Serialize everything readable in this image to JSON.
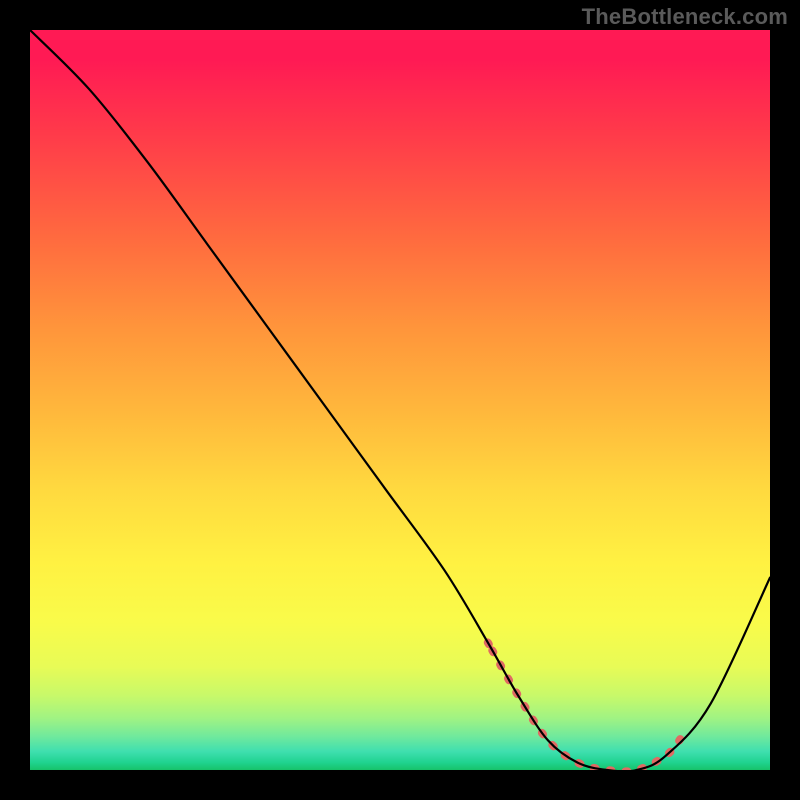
{
  "watermark": "TheBottleneck.com",
  "chart_data": {
    "type": "line",
    "title": "",
    "xlabel": "",
    "ylabel": "",
    "xlim": [
      0,
      100
    ],
    "ylim": [
      0,
      100
    ],
    "grid": false,
    "series": [
      {
        "name": "curve",
        "x": [
          0,
          8,
          16,
          24,
          32,
          40,
          48,
          56,
          62,
          66,
          70,
          74,
          78,
          82,
          86,
          92,
          100
        ],
        "y": [
          100,
          92,
          82,
          71,
          60,
          49,
          38,
          27,
          17,
          10,
          4,
          1,
          0,
          0,
          2,
          9,
          26
        ]
      }
    ],
    "highlight_range_x": [
      62,
      88
    ],
    "background_gradient": {
      "top": "#ff1a54",
      "mid": "#fff142",
      "bottom": "#17c26a"
    }
  }
}
